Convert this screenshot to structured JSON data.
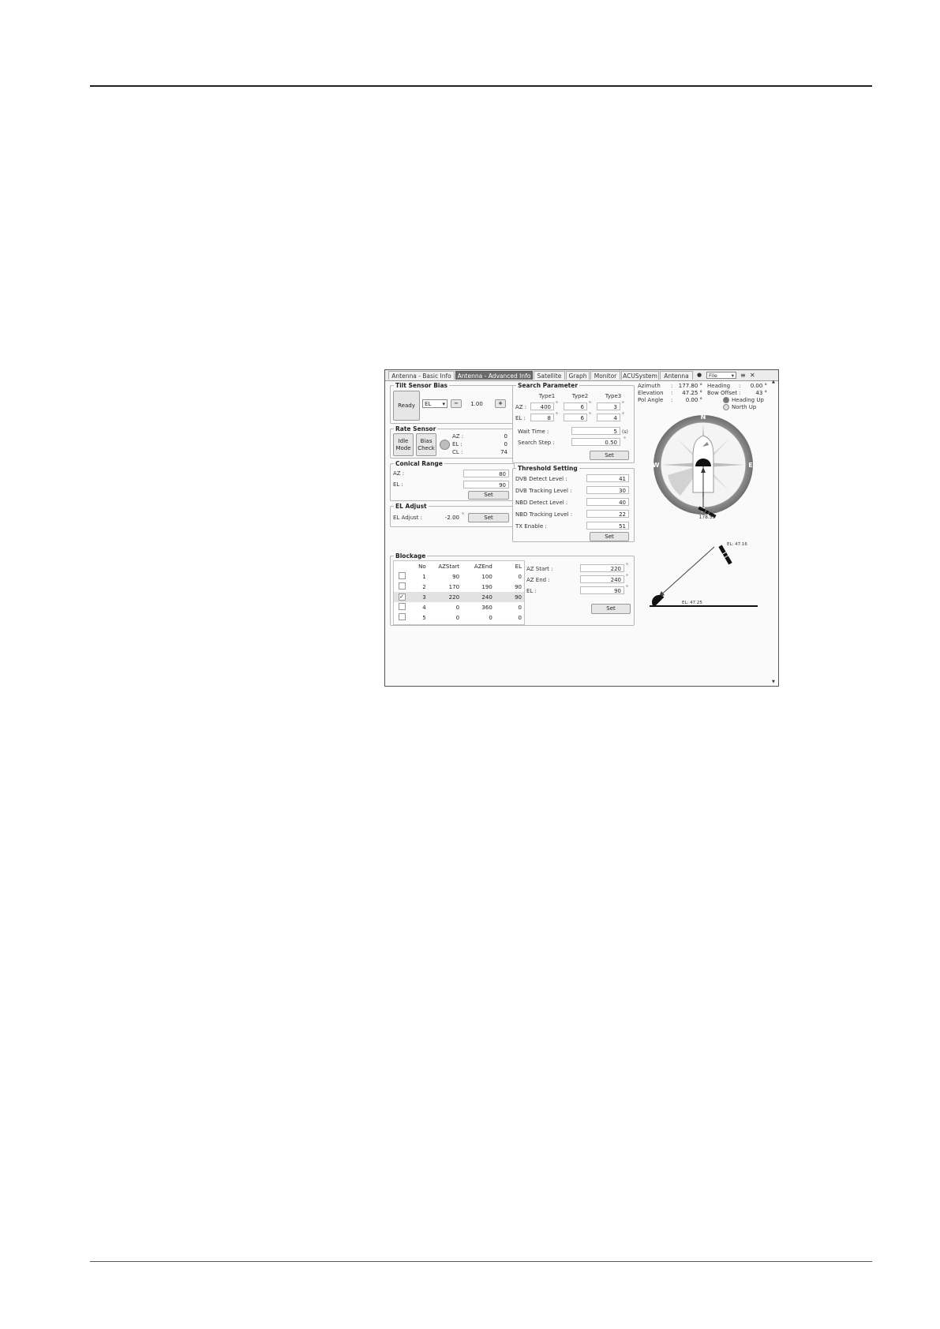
{
  "tabs": [
    {
      "label": "Antenna - Basic Info",
      "active": false
    },
    {
      "label": "Antenna - Advanced Info",
      "active": true
    },
    {
      "label": "Satellite",
      "active": false
    },
    {
      "label": "Graph",
      "active": false
    },
    {
      "label": "Monitor",
      "active": false
    },
    {
      "label": "ACUSystem",
      "active": false
    },
    {
      "label": "Antenna UI",
      "active": false
    }
  ],
  "tab_controls": {
    "file_combo": "File"
  },
  "tilt_sensor_bias": {
    "title": "Tilt Sensor Bias",
    "ready_label": "Ready",
    "axis_select": "EL",
    "minus_label": "−",
    "value": "1.00",
    "plus_label": "+"
  },
  "rate_sensor": {
    "title": "Rate Sensor",
    "idle_mode_label": "Idle Mode",
    "bias_check_label": "Bias Check",
    "readings": [
      {
        "label": "AZ :",
        "value": "0"
      },
      {
        "label": "EL :",
        "value": "0"
      },
      {
        "label": "CL :",
        "value": "74"
      }
    ]
  },
  "conical_range": {
    "title": "Conical Range",
    "az_label": "AZ :",
    "az_value": "80",
    "el_label": "EL :",
    "el_value": "90",
    "set_label": "Set"
  },
  "el_adjust": {
    "title": "EL Adjust",
    "label": "EL Adjust :",
    "value": "-2.00",
    "unit": "°",
    "set_label": "Set"
  },
  "search_parameter": {
    "title": "Search Parameter",
    "headers": [
      "Type1",
      "Type2",
      "Type3"
    ],
    "az_label": "AZ :",
    "az_values": [
      "400",
      "6",
      "3"
    ],
    "el_label": "EL :",
    "el_values": [
      "8",
      "6",
      "4"
    ],
    "unit": "°",
    "wait_time_label": "Wait Time :",
    "wait_time_value": "5",
    "wait_time_unit": "(s)",
    "search_step_label": "Search Step :",
    "search_step_value": "0.50",
    "search_step_unit": "°",
    "set_label": "Set"
  },
  "threshold_setting": {
    "title": "Threshold Setting",
    "rows": [
      {
        "label": "DVB Detect Level :",
        "value": "41"
      },
      {
        "label": "DVB Tracking Level :",
        "value": "30"
      },
      {
        "label": "NBD Detect Level :",
        "value": "40"
      },
      {
        "label": "NBD Tracking Level :",
        "value": "22"
      },
      {
        "label": "TX Enable :",
        "value": "51"
      }
    ],
    "set_label": "Set"
  },
  "blockage": {
    "title": "Blockage",
    "columns": [
      "No",
      "AZStart",
      "AZEnd",
      "EL"
    ],
    "rows": [
      {
        "checked": false,
        "no": "1",
        "az_start": "90",
        "az_end": "100",
        "el": "0"
      },
      {
        "checked": false,
        "no": "2",
        "az_start": "170",
        "az_end": "190",
        "el": "90"
      },
      {
        "checked": true,
        "no": "3",
        "az_start": "220",
        "az_end": "240",
        "el": "90"
      },
      {
        "checked": false,
        "no": "4",
        "az_start": "0",
        "az_end": "360",
        "el": "0"
      },
      {
        "checked": false,
        "no": "5",
        "az_start": "0",
        "az_end": "0",
        "el": "0"
      }
    ],
    "az_start_label": "AZ Start :",
    "az_start_value": "220",
    "az_end_label": "AZ End :",
    "az_end_value": "240",
    "el_label": "EL :",
    "el_value": "90",
    "unit": "°",
    "set_label": "Set"
  },
  "status": {
    "azimuth_label": "Azimuth",
    "azimuth_value": "177.80 °",
    "elevation_label": "Elevation",
    "elevation_value": "47.25 °",
    "pol_label": "Pol Angle",
    "pol_value": "0.00 °",
    "heading_label": "Heading",
    "heading_value": "0.00 °",
    "bow_label": "Bow Offset",
    "bow_value": "43 °",
    "sep": ":",
    "heading_up_label": "Heading Up",
    "north_up_label": "North Up"
  },
  "compass": {
    "n": "N",
    "e": "E",
    "s": "S",
    "w": "W",
    "az_readout": "178.59"
  },
  "elevation_view": {
    "sat_label": "EL: 47.16",
    "ant_label": "EL: 47.25"
  }
}
